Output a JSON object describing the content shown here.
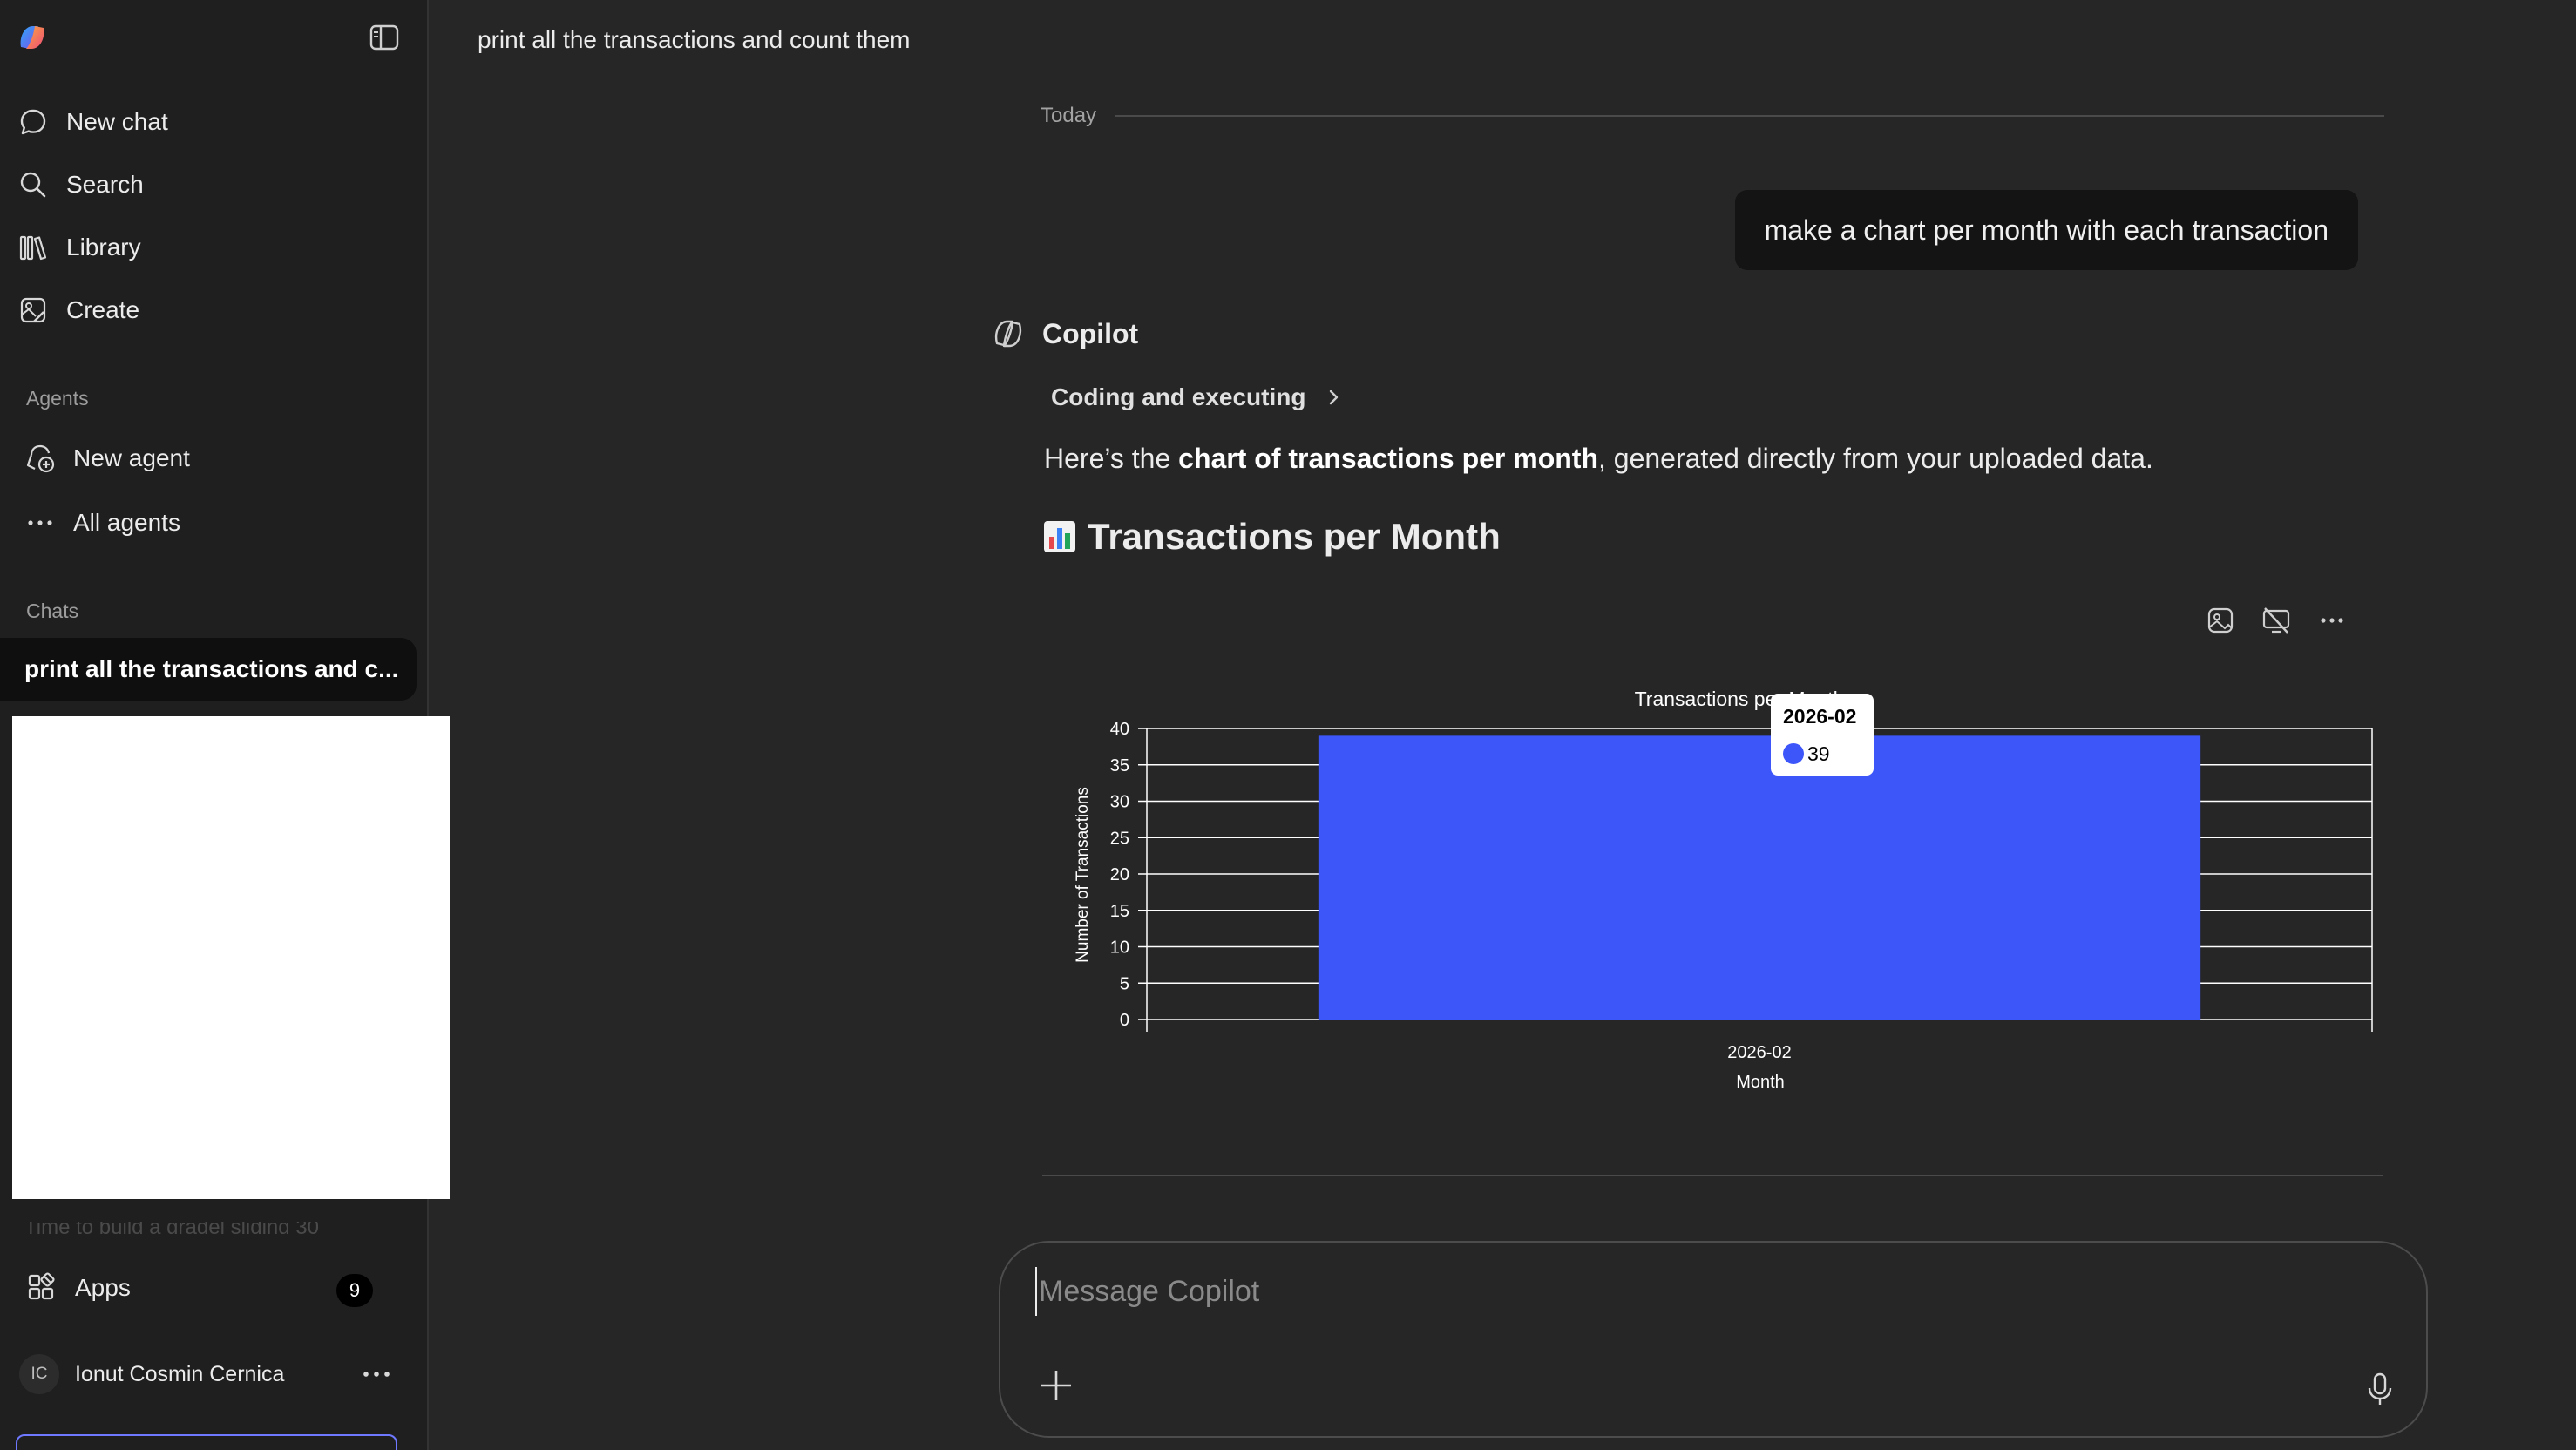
{
  "sidebar": {
    "nav": {
      "new_chat": "New chat",
      "search": "Search",
      "library": "Library",
      "create": "Create"
    },
    "agents_label": "Agents",
    "agents": {
      "new_agent": "New agent",
      "all_agents": "All agents"
    },
    "chats_label": "Chats",
    "active_chat": "print all the transactions and c...",
    "faded_chat": "Time to build a gradel sliding 30",
    "apps_label": "Apps",
    "apps_badge": "9",
    "profile": {
      "initials": "IC",
      "name": "Ionut Cosmin Cernica"
    }
  },
  "main": {
    "conversation_title": "print all the transactions and count them",
    "today_label": "Today",
    "user_message": "make a chart per month with each transaction",
    "assistant_name": "Copilot",
    "status_step": "Coding and executing",
    "answer": {
      "prefix": "Here’s the ",
      "bold": "chart of transactions per month",
      "suffix": ", generated directly from your uploaded data."
    },
    "chart_heading": "Transactions per Month"
  },
  "chart_data": {
    "type": "bar",
    "title": "Transactions per Month",
    "xlabel": "Month",
    "ylabel": "Number of Transactions",
    "categories": [
      "2026-02"
    ],
    "values": [
      39
    ],
    "ylim": [
      0,
      40
    ],
    "yticks": [
      0,
      5,
      10,
      15,
      20,
      25,
      30,
      35,
      40
    ],
    "grid": true,
    "bar_color": "#3d56fa",
    "tooltip": {
      "label": "2026-02",
      "value": "39"
    }
  },
  "composer": {
    "placeholder": "Message Copilot"
  },
  "colors": {
    "background": "#262626",
    "sidebar": "#1f1f1f",
    "bubble": "#141414",
    "accent": "#3d56fa"
  }
}
